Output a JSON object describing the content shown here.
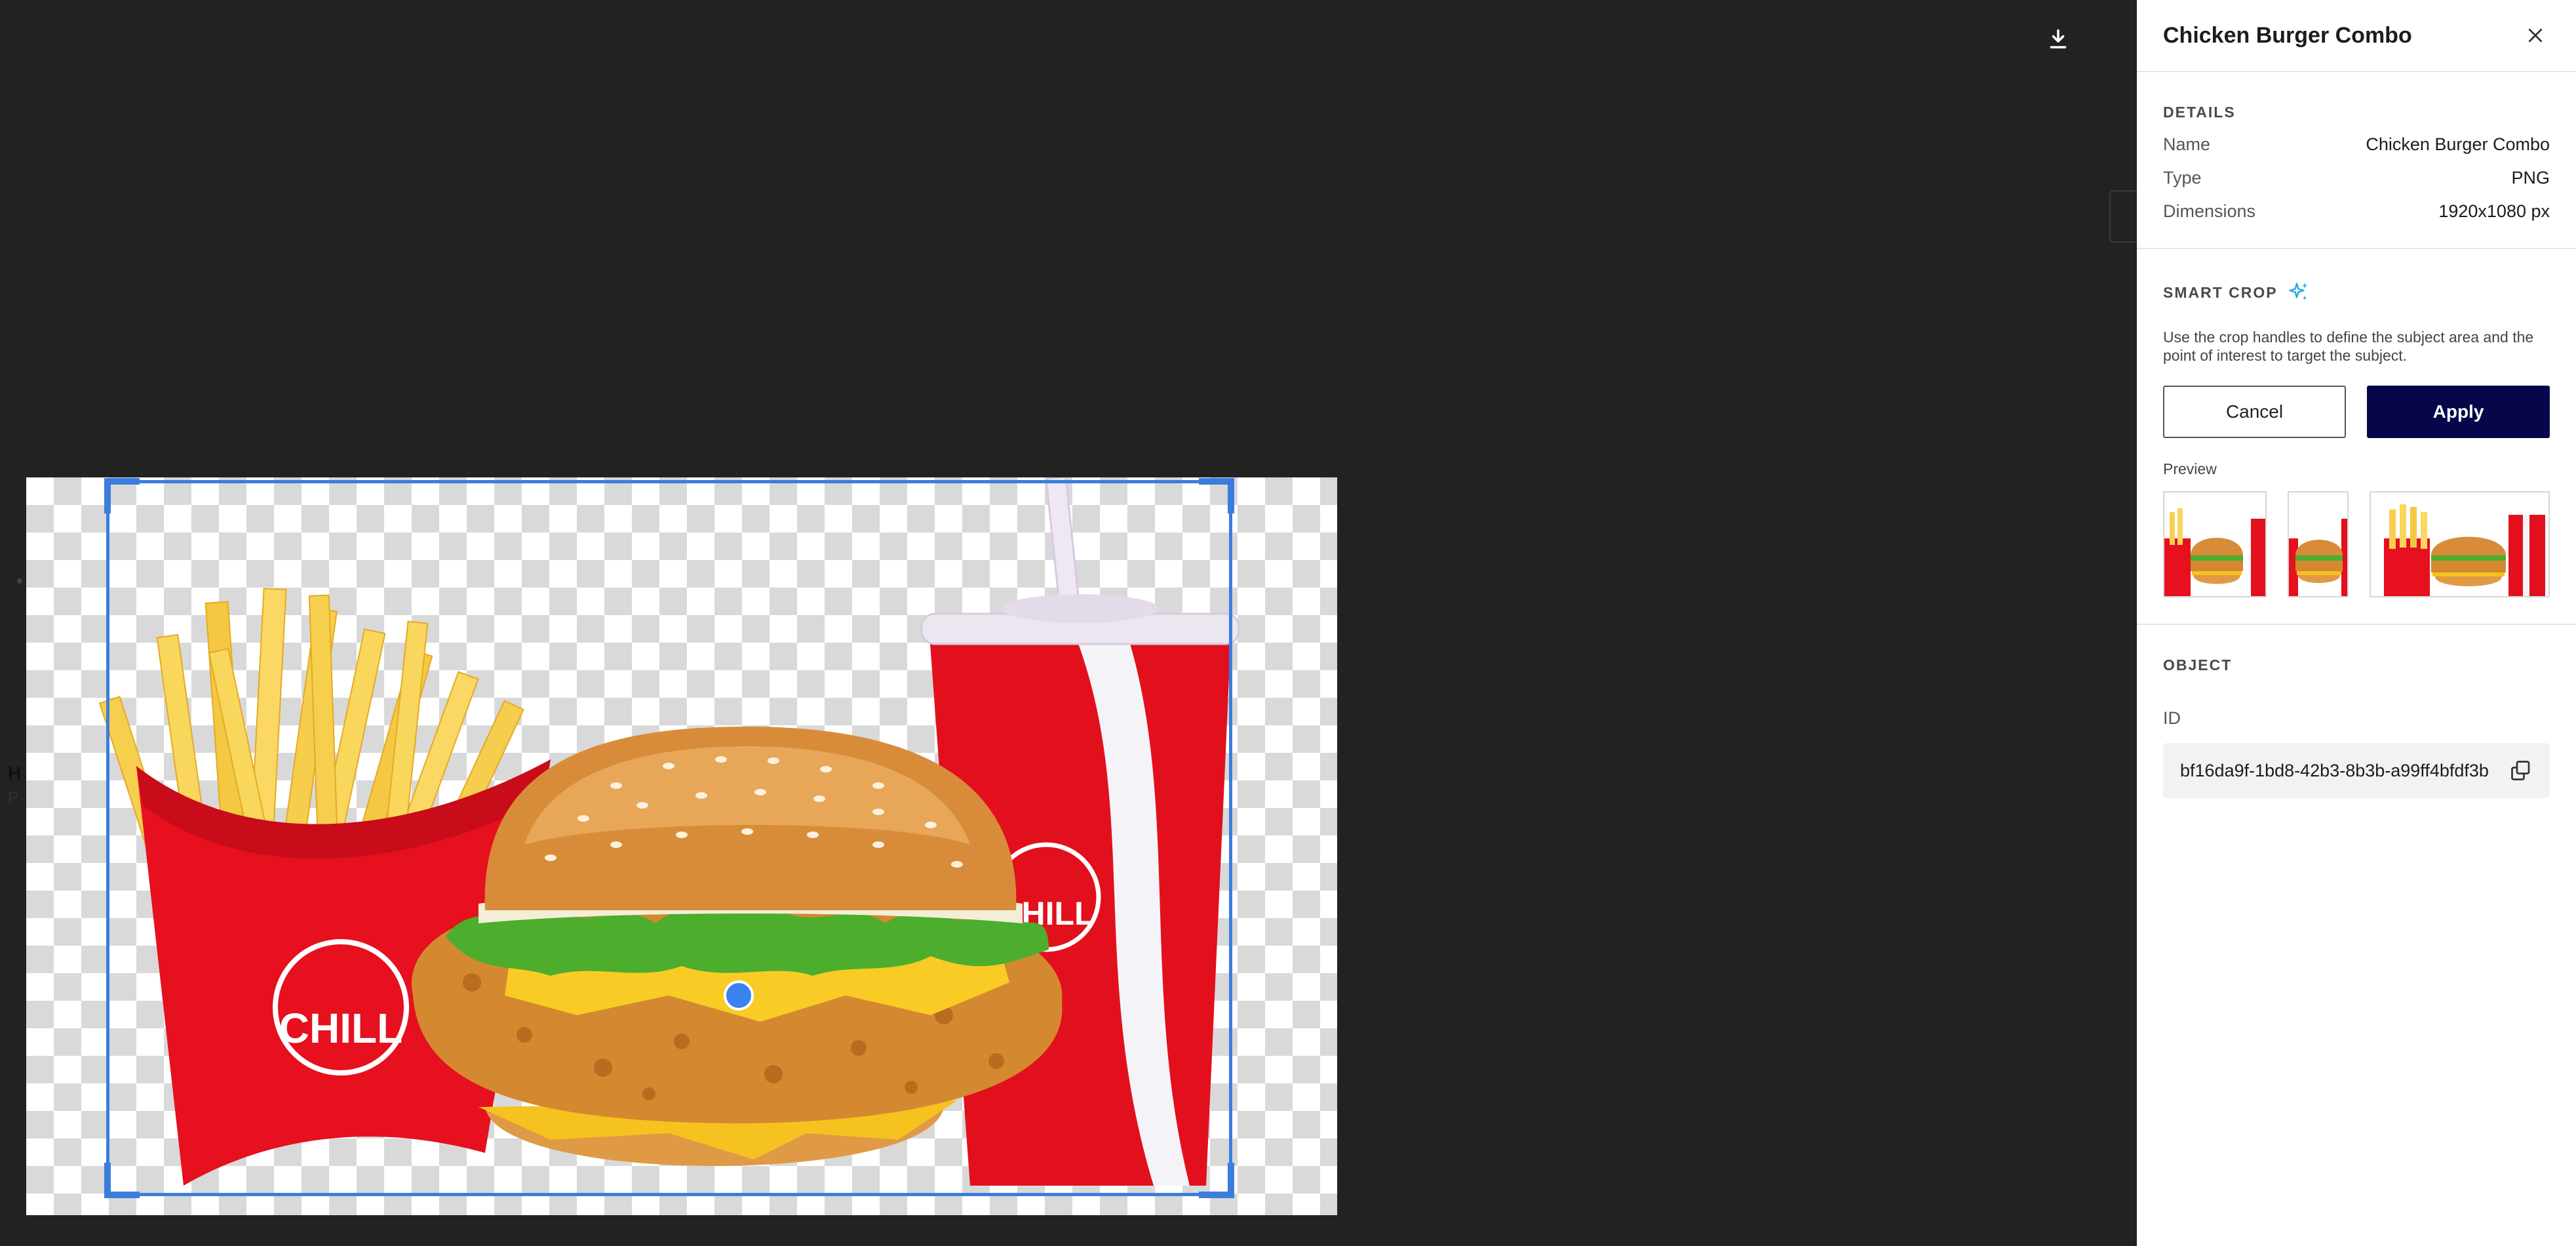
{
  "panel": {
    "title": "Chicken Burger Combo",
    "details": {
      "heading": "DETAILS",
      "rows": [
        {
          "key": "Name",
          "value": "Chicken Burger Combo"
        },
        {
          "key": "Type",
          "value": "PNG"
        },
        {
          "key": "Dimensions",
          "value": "1920x1080 px"
        }
      ]
    },
    "smart_crop": {
      "heading": "SMART CROP",
      "description": "Use the crop handles to define the subject area and the point of interest to target the subject.",
      "cancel_label": "Cancel",
      "apply_label": "Apply",
      "preview_label": "Preview"
    },
    "object": {
      "heading": "OBJECT",
      "id_label": "ID",
      "id_value": "bf16da9f-1bd8-42b3-8b3b-a99ff4bfdf3b"
    }
  },
  "image": {
    "cup_logo_text": "CHILL",
    "fries_logo_text": "CHILL"
  },
  "background": {
    "partial_heading": "H",
    "partial_text": "P"
  },
  "icons": {
    "download": "download-icon",
    "close": "close-icon",
    "sparkle": "sparkle-icon",
    "copy": "copy-icon"
  },
  "colors": {
    "overlay": "#222222",
    "crop_accent": "#3b7ddd",
    "apply_button": "#07064a",
    "sparkle": "#29a8e0"
  }
}
